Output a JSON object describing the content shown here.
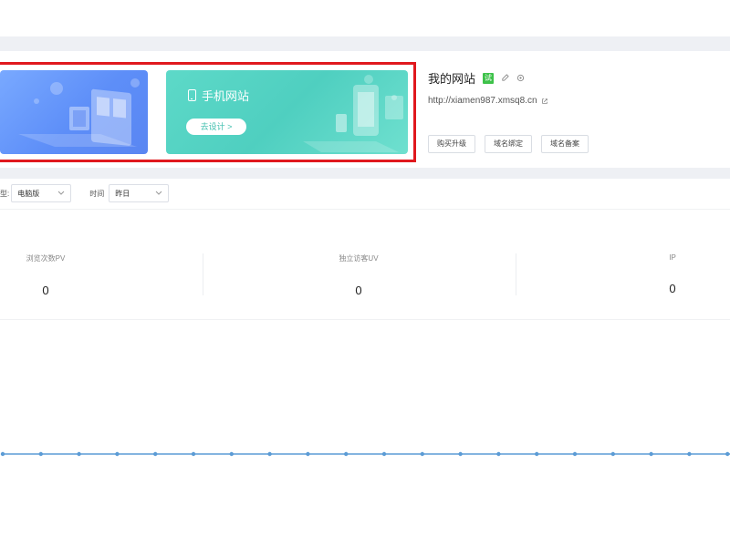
{
  "banner": {
    "mobile_title": "手机网站",
    "design_button": "去设计 >"
  },
  "site": {
    "title": "我的网站",
    "badge": "试",
    "url": "http://xiamen987.xmsq8.cn",
    "buttons": [
      "购买升级",
      "域名绑定",
      "域名备案"
    ]
  },
  "filters": {
    "type_label": "型:",
    "type_value": "电脑版",
    "time_label": "时间",
    "time_value": "昨日"
  },
  "stats": [
    {
      "label": "浏览次数PV",
      "value": "0"
    },
    {
      "label": "独立访客UV",
      "value": "0"
    },
    {
      "label": "IP",
      "value": "0"
    }
  ],
  "colors": {
    "highlight": "#e0191e",
    "line": "#5b9bd5",
    "badge": "#3ec24a"
  },
  "chart_data": {
    "type": "line",
    "series": [
      {
        "values": [
          0,
          0,
          0,
          0,
          0,
          0,
          0,
          0,
          0,
          0,
          0,
          0,
          0,
          0,
          0,
          0,
          0,
          0,
          0,
          0
        ]
      }
    ]
  }
}
